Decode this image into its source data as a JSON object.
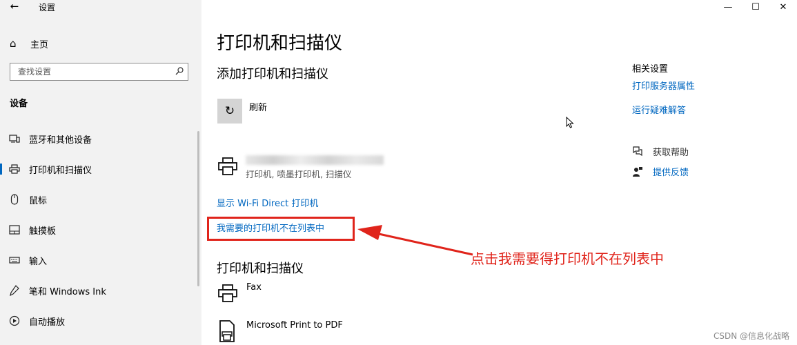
{
  "window": {
    "title": "设置",
    "controls": {
      "minimize": "—",
      "maximize": "☐",
      "close": "✕"
    }
  },
  "sidebar": {
    "home_label": "主页",
    "search_placeholder": "查找设置",
    "section_title": "设备",
    "items": [
      {
        "label": "蓝牙和其他设备",
        "icon": "bluetooth-devices-icon",
        "active": false
      },
      {
        "label": "打印机和扫描仪",
        "icon": "printer-icon",
        "active": true
      },
      {
        "label": "鼠标",
        "icon": "mouse-icon",
        "active": false
      },
      {
        "label": "触摸板",
        "icon": "touchpad-icon",
        "active": false
      },
      {
        "label": "输入",
        "icon": "keyboard-icon",
        "active": false
      },
      {
        "label": "笔和 Windows Ink",
        "icon": "pen-icon",
        "active": false
      },
      {
        "label": "自动播放",
        "icon": "autoplay-icon",
        "active": false
      }
    ]
  },
  "main": {
    "page_title": "打印机和扫描仪",
    "add_section_title": "添加打印机和扫描仪",
    "refresh_label": "刷新",
    "found_device_desc": "打印机, 喷墨打印机, 扫描仪",
    "wifi_direct_link": "显示 Wi-Fi Direct 打印机",
    "not_listed_link": "我需要的打印机不在列表中",
    "list_section_title": "打印机和扫描仪",
    "printers": [
      {
        "name": "Fax",
        "icon": "printer-icon"
      },
      {
        "name": "Microsoft Print to PDF",
        "icon": "pdf-printer-icon"
      }
    ]
  },
  "related": {
    "title": "相关设置",
    "links": [
      "打印服务器属性",
      "运行疑难解答"
    ],
    "get_help": "获取帮助",
    "feedback": "提供反馈"
  },
  "annotation": {
    "text": "点击我需要得打印机不在列表中",
    "color": "#e0241b"
  },
  "watermark": "CSDN @信息化战略",
  "colors": {
    "accent": "#0067c0",
    "sidebar_bg": "#f2f2f2",
    "highlight": "#e0241b"
  }
}
